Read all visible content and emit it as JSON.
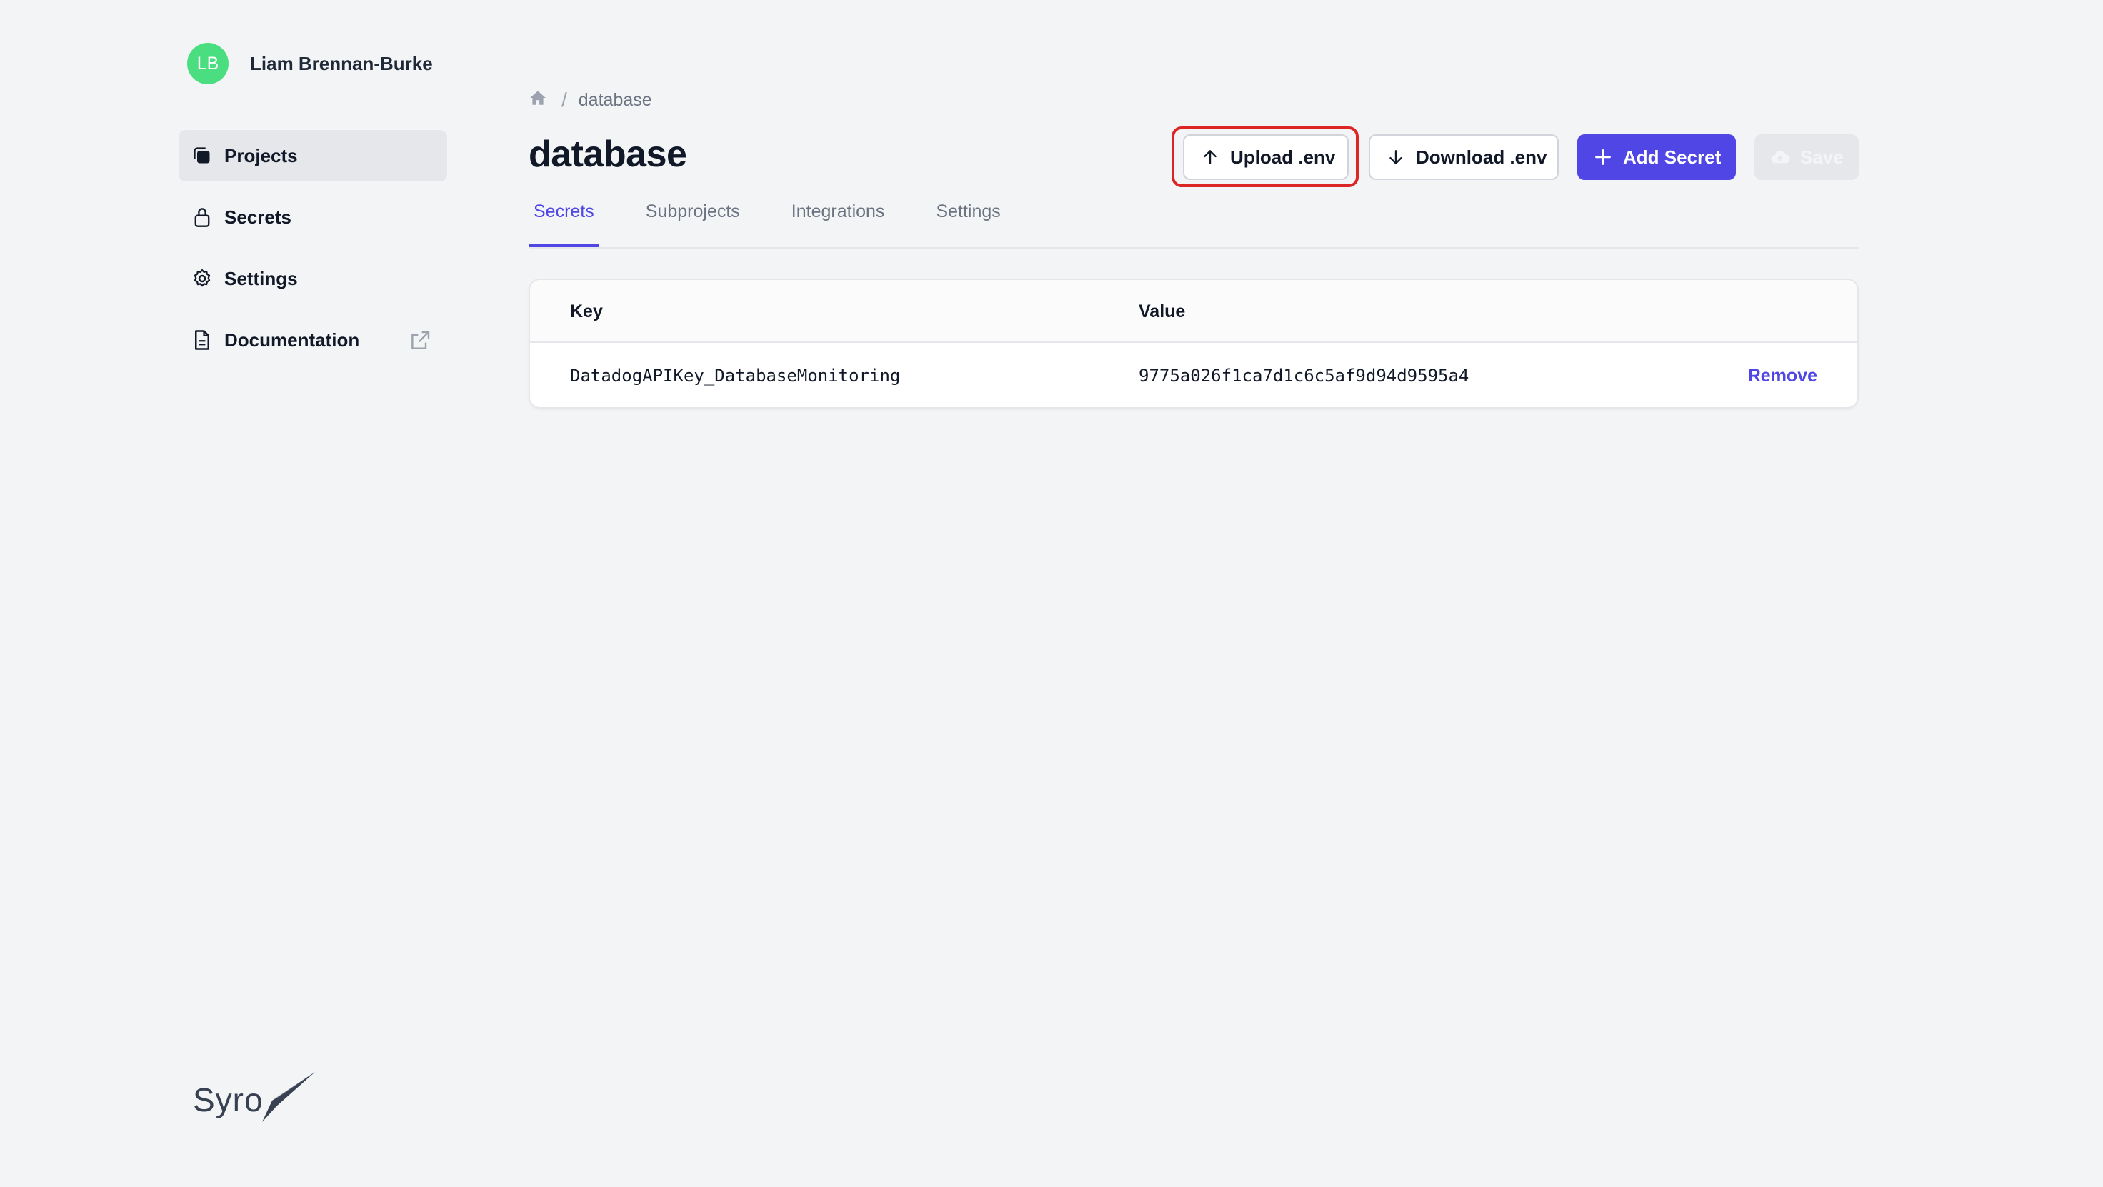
{
  "user": {
    "initials": "LB",
    "name": "Liam Brennan-Burke"
  },
  "sidebar": {
    "items": [
      {
        "label": "Projects",
        "icon": "projects-icon",
        "active": true
      },
      {
        "label": "Secrets",
        "icon": "lock-icon"
      },
      {
        "label": "Settings",
        "icon": "gear-icon"
      },
      {
        "label": "Documentation",
        "icon": "document-icon",
        "external": true
      }
    ]
  },
  "brand": {
    "name": "Syro"
  },
  "breadcrumb": {
    "current": "database"
  },
  "page": {
    "title": "database"
  },
  "toolbar": {
    "upload_label": "Upload .env",
    "download_label": "Download .env",
    "add_label": "Add Secret",
    "save_label": "Save"
  },
  "tabs": [
    "Secrets",
    "Subprojects",
    "Integrations",
    "Settings"
  ],
  "table": {
    "headers": [
      "Key",
      "Value"
    ],
    "rows": [
      {
        "key": "DatadogAPIKey_DatabaseMonitoring",
        "value": "9775a026f1ca7d1c6c5af9d94d9595a4",
        "action": "Remove"
      }
    ]
  },
  "colors": {
    "accent": "#4f46e5",
    "highlight": "#dc2626",
    "avatar": "#4ade80"
  }
}
